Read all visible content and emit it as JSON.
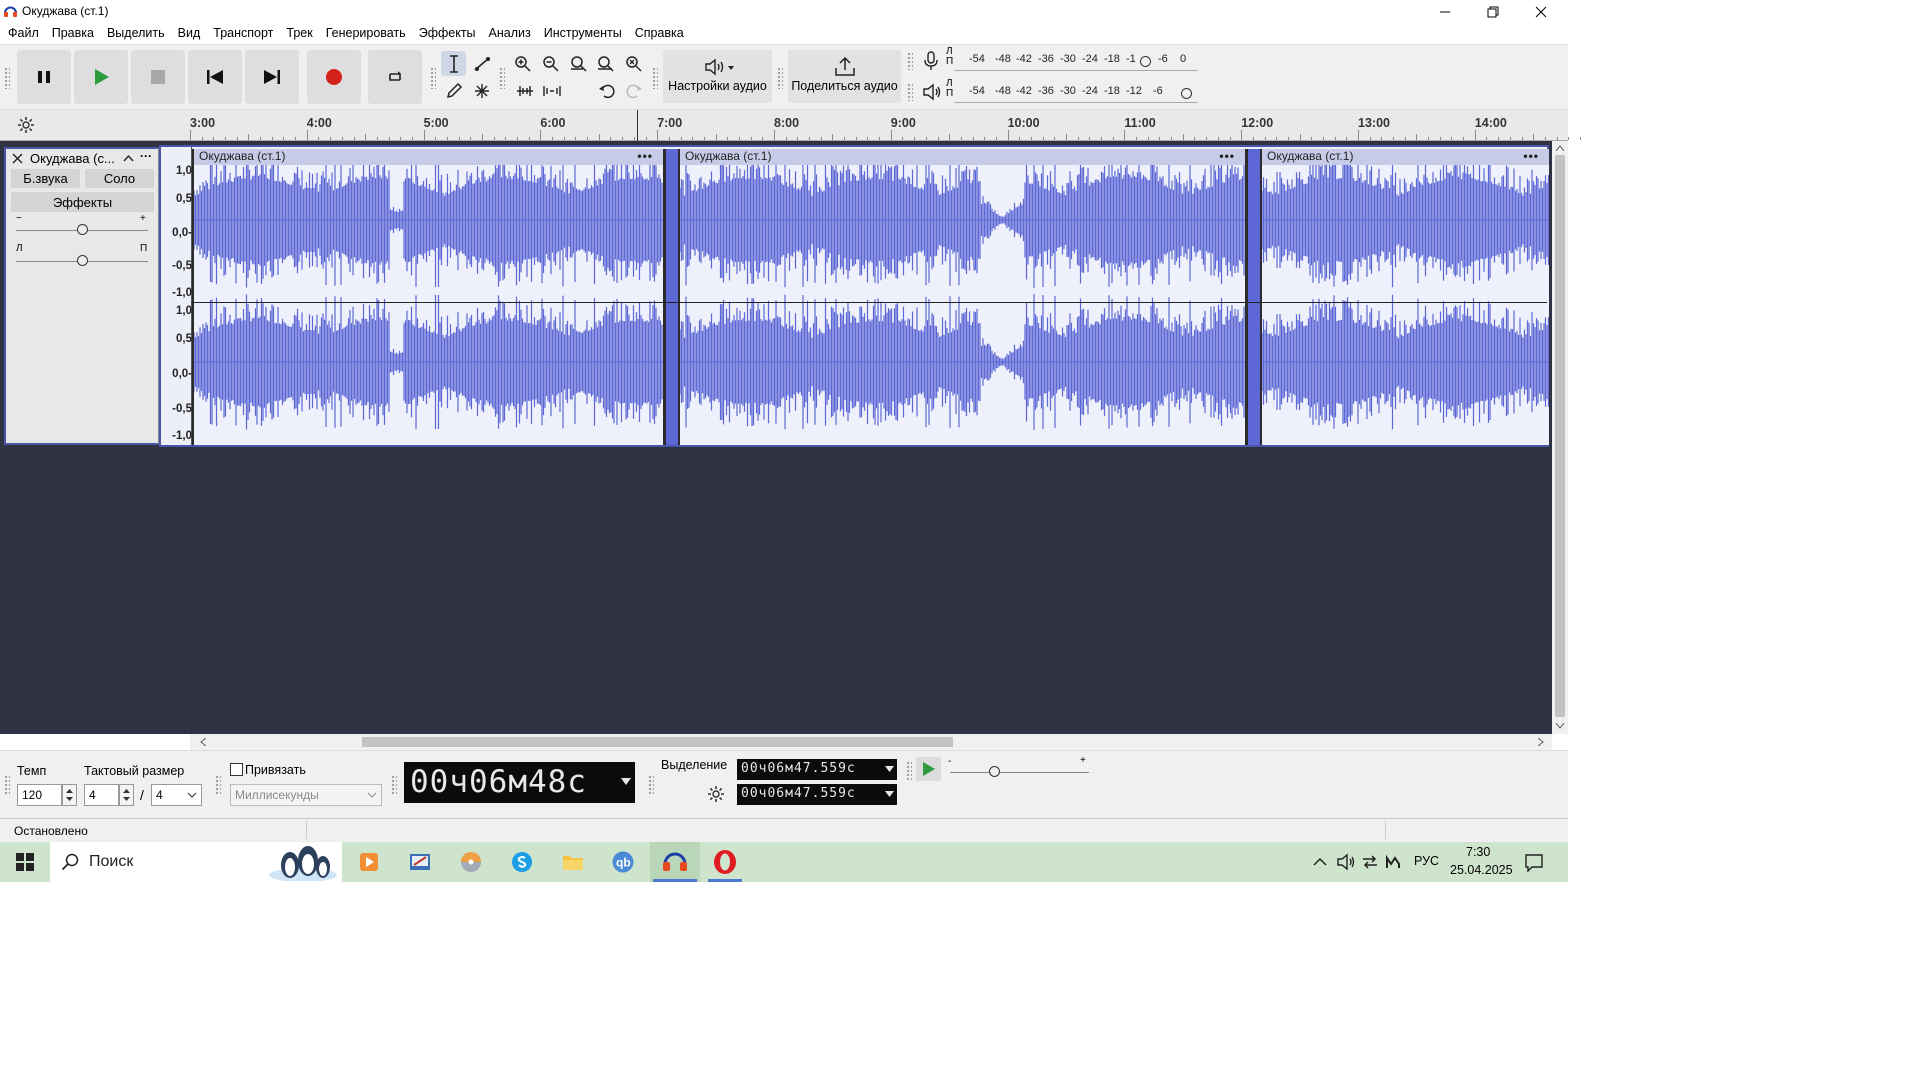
{
  "window": {
    "title": "Окуджава (ст.1)"
  },
  "menu": [
    "Файл",
    "Правка",
    "Выделить",
    "Вид",
    "Транспорт",
    "Трек",
    "Генерировать",
    "Эффекты",
    "Анализ",
    "Инструменты",
    "Справка"
  ],
  "toolbar": {
    "audio_setup_label": "Настройки аудио",
    "share_label": "Поделиться аудио",
    "rec_meter_ticks": [
      "-54",
      "-48",
      "-42",
      "-36",
      "-30",
      "-24",
      "-18",
      "-1",
      "-6",
      "0"
    ],
    "play_meter_ticks": [
      "-54",
      "-48",
      "-42",
      "-36",
      "-30",
      "-24",
      "-18",
      "-12",
      "-6"
    ],
    "meter_lr": [
      "Л",
      "П"
    ]
  },
  "ruler": {
    "ticks": [
      "3:00",
      "4:00",
      "5:00",
      "6:00",
      "7:00",
      "8:00",
      "9:00",
      "10:00",
      "11:00",
      "12:00",
      "13:00",
      "14:00"
    ]
  },
  "track": {
    "name": "Окуджава (с...",
    "mute_label": "Б.звука",
    "solo_label": "Соло",
    "effects_label": "Эффекты",
    "gain_minus": "−",
    "gain_plus": "+",
    "pan_left": "Л",
    "pan_right": "П",
    "vscale": [
      "1,0",
      "0,5",
      "0,0-",
      "-0,5",
      "-1,0"
    ],
    "vscale2": [
      "1,0",
      "0,5",
      "0,0-",
      "-0,5",
      "-1,0"
    ],
    "clips": [
      {
        "name": "Окуджава (ст.1)",
        "menu": "•••"
      },
      {
        "name": "Окуджава (ст.1)",
        "menu": "•••"
      },
      {
        "name": "Окуджава (ст.1)",
        "menu": "•••"
      }
    ]
  },
  "bottom": {
    "tempo_label": "Темп",
    "tempo_value": "120",
    "timesig_label": "Тактовый размер",
    "timesig_num": "4",
    "timesig_sep": "/",
    "timesig_den": "4",
    "snap_label": "Привязать",
    "snap_unit": "Миллисекунды",
    "time_display": "00ч06м48с",
    "selection_label": "Выделение",
    "sel_start": "00ч06м47.559с",
    "sel_end": "00ч06м47.559с",
    "speed_minus": "-",
    "speed_plus": "+"
  },
  "status": {
    "text": "Остановлено"
  },
  "taskbar": {
    "search_placeholder": "Поиск",
    "lang": "РУС",
    "time": "7:30",
    "date": "25.04.2025"
  },
  "colors": {
    "waveform": "#5d68d6",
    "clip_header": "#c6cbe7",
    "track_bg": "#2f3243",
    "accent": "#4a57a8"
  }
}
